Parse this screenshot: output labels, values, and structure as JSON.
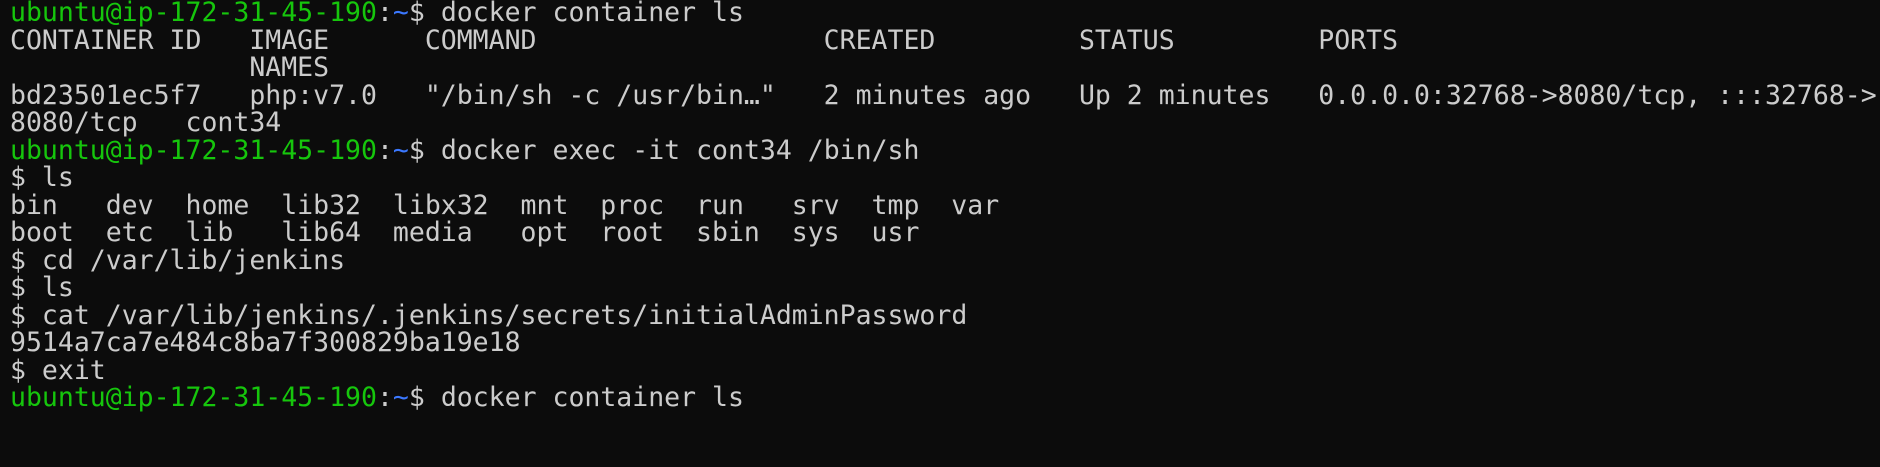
{
  "terminal": {
    "prompt": {
      "user_host": "ubuntu@ip-172-31-45-190",
      "colon": ":",
      "path": "~",
      "symbol": "$ "
    },
    "command_1": "docker container ls",
    "table_header_line": "CONTAINER ID   IMAGE      COMMAND                  CREATED         STATUS         PORTS",
    "table_header_wrap": "               NAMES",
    "table_row_line": "bd23501ec5f7   php:v7.0   \"/bin/sh -c /usr/bin…\"   2 minutes ago   Up 2 minutes   0.0.0.0:32768->8080/tcp, :::32768->",
    "table_row_wrap": "8080/tcp   cont34",
    "command_2": "docker exec -it cont34 /bin/sh",
    "sh_prompt": "$ ",
    "cmd_ls_1": "ls",
    "ls_output_1": "bin   dev  home  lib32  libx32  mnt  proc  run   srv  tmp  var",
    "ls_output_2": "boot  etc  lib   lib64  media   opt  root  sbin  sys  usr",
    "cmd_cd": "cd /var/lib/jenkins",
    "cmd_ls_2": "ls",
    "cmd_cat": "cat /var/lib/jenkins/.jenkins/secrets/initialAdminPassword",
    "password_output": "9514a7ca7e484c8ba7f300829ba19e18",
    "cmd_exit": "exit",
    "partial_user_host": "ubuntu@ip-172-31-45-190",
    "partial_colon": ":",
    "partial_path": "~",
    "partial_symbol": "$ ",
    "partial_command": "docker container ls"
  },
  "colors": {
    "background": "#0c0c0c",
    "text": "#cccccc",
    "prompt_user": "#16c60c",
    "prompt_path": "#3b78ff"
  }
}
